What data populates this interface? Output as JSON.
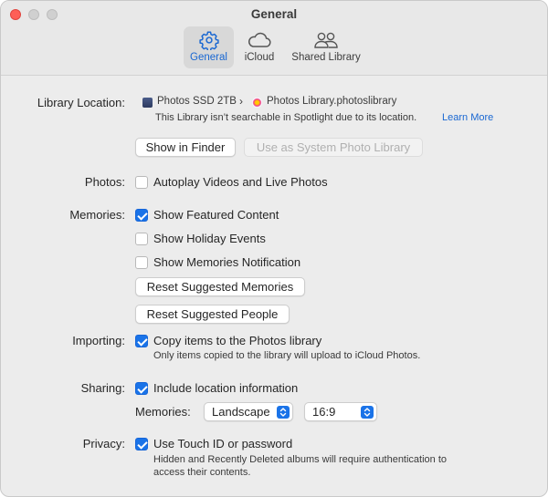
{
  "window": {
    "title": "General",
    "tabs": [
      {
        "label": "General",
        "icon": "gear-icon",
        "active": true
      },
      {
        "label": "iCloud",
        "icon": "cloud-icon",
        "active": false
      },
      {
        "label": "Shared Library",
        "icon": "people-icon",
        "active": false
      }
    ]
  },
  "library": {
    "label": "Library Location:",
    "drive": "Photos SSD 2TB",
    "separator": "›",
    "library_name": "Photos Library.photoslibrary",
    "note": "This Library isn’t searchable in Spotlight due to its location.",
    "learn_more": "Learn More",
    "show_in_finder": "Show in Finder",
    "use_as_system": "Use as System Photo Library"
  },
  "photos": {
    "label": "Photos:",
    "autoplay": {
      "label": "Autoplay Videos and Live Photos",
      "checked": false
    }
  },
  "memories": {
    "label": "Memories:",
    "featured": {
      "label": "Show Featured Content",
      "checked": true
    },
    "holiday": {
      "label": "Show Holiday Events",
      "checked": false
    },
    "notification": {
      "label": "Show Memories Notification",
      "checked": false
    },
    "reset_memories": "Reset Suggested Memories",
    "reset_people": "Reset Suggested People"
  },
  "importing": {
    "label": "Importing:",
    "copy": {
      "label": "Copy items to the Photos library",
      "checked": true
    },
    "note": "Only items copied to the library will upload to iCloud Photos."
  },
  "sharing": {
    "label": "Sharing:",
    "location": {
      "label": "Include location information",
      "checked": true
    },
    "memories_label": "Memories:",
    "orientation": "Landscape",
    "ratio": "16:9"
  },
  "privacy": {
    "label": "Privacy:",
    "touch_id": {
      "label": "Use Touch ID or password",
      "checked": true
    },
    "note_line1": "Hidden and Recently Deleted albums will require authentication to",
    "note_line2": "access their contents."
  },
  "colors": {
    "accent": "#1a73e8",
    "close": "#fe5f57"
  }
}
